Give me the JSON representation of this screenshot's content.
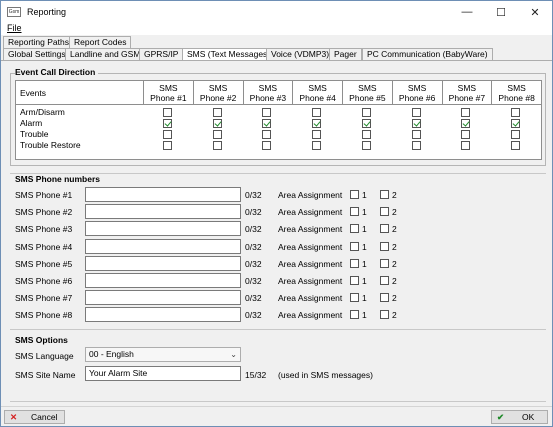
{
  "window": {
    "title": "Reporting",
    "icon_text": "Gsm",
    "controls": [
      "—",
      "☐",
      "✕"
    ]
  },
  "menu": {
    "file": "File"
  },
  "tabs_row1": [
    "Reporting Paths",
    "Report Codes"
  ],
  "tabs_row2": [
    "Global Settings",
    "Landline and GSM",
    "GPRS/IP",
    "SMS (Text Messages)",
    "Voice (VDMP3)",
    "Pager",
    "PC Communication (BabyWare)"
  ],
  "event_call": {
    "title": "Event Call Direction",
    "events_header": "Events",
    "phone_header_line1": "SMS",
    "phones": [
      "Phone #1",
      "Phone #2",
      "Phone #3",
      "Phone #4",
      "Phone #5",
      "Phone #6",
      "Phone #7",
      "Phone #8"
    ],
    "rows": [
      {
        "label": "Arm/Disarm",
        "checks": [
          false,
          false,
          false,
          false,
          false,
          false,
          false,
          false
        ]
      },
      {
        "label": "Alarm",
        "checks": [
          true,
          true,
          true,
          true,
          true,
          true,
          true,
          true
        ]
      },
      {
        "label": "Trouble",
        "checks": [
          false,
          false,
          false,
          false,
          false,
          false,
          false,
          false
        ]
      },
      {
        "label": "Trouble Restore",
        "checks": [
          false,
          false,
          false,
          false,
          false,
          false,
          false,
          false
        ]
      }
    ]
  },
  "sms_phones": {
    "title": "SMS Phone numbers",
    "area_label": "Area Assignment",
    "area1": "1",
    "area2": "2",
    "rows": [
      {
        "label": "SMS Phone #1",
        "value": "",
        "count": "0/32"
      },
      {
        "label": "SMS Phone #2",
        "value": "",
        "count": "0/32"
      },
      {
        "label": "SMS Phone #3",
        "value": "",
        "count": "0/32"
      },
      {
        "label": "SMS Phone #4",
        "value": "",
        "count": "0/32"
      },
      {
        "label": "SMS Phone #5",
        "value": "",
        "count": "0/32"
      },
      {
        "label": "SMS Phone #6",
        "value": "",
        "count": "0/32"
      },
      {
        "label": "SMS Phone #7",
        "value": "",
        "count": "0/32"
      },
      {
        "label": "SMS Phone #8",
        "value": "",
        "count": "0/32"
      }
    ]
  },
  "sms_options": {
    "title": "SMS Options",
    "language_label": "SMS Language",
    "language_value": "00 - English",
    "site_label": "SMS Site Name",
    "site_value": "Your Alarm Site",
    "site_count": "15/32",
    "site_note": "(used in SMS messages)"
  },
  "buttons": {
    "cancel": "Cancel",
    "ok": "OK"
  },
  "colors": {
    "check": "#1f8a2a",
    "cancel_icon": "#d42020",
    "ok_icon": "#1f8a2a"
  }
}
